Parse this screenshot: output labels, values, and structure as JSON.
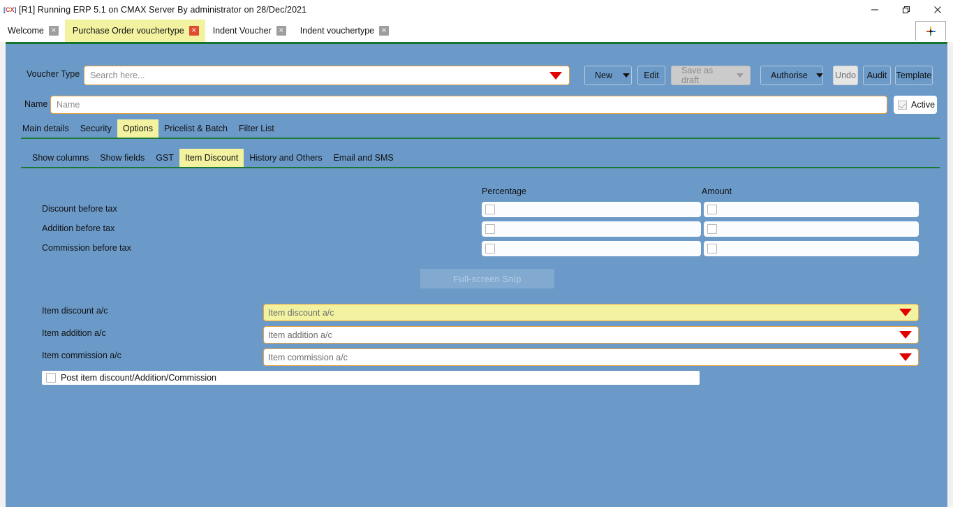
{
  "window": {
    "title": "[R1] Running ERP 5.1 on CMAX Server By administrator on 28/Dec/2021",
    "app_icon_text": "CX",
    "minimize_icon": "minimize-icon",
    "maximize_icon": "restore-icon",
    "close_icon": "close-icon"
  },
  "tabs": {
    "items": [
      {
        "label": "Welcome",
        "active": false,
        "close": "×"
      },
      {
        "label": "Purchase Order vouchertype",
        "active": true,
        "close": "×"
      },
      {
        "label": "Indent Voucher",
        "active": false,
        "close": "×"
      },
      {
        "label": "Indent vouchertype",
        "active": false,
        "close": "×"
      }
    ],
    "new_tab_label": "+"
  },
  "toolbar": {
    "voucher_type_label": "Voucher Type",
    "search_placeholder": "Search here...",
    "search_value": "",
    "buttons": [
      {
        "label": "New",
        "split": true,
        "disabled": false
      },
      {
        "label": "Edit",
        "split": false,
        "disabled": false
      },
      {
        "label": "Save as draft",
        "split": true,
        "disabled": true
      },
      {
        "label": "Authorise",
        "split": true,
        "disabled": false
      },
      {
        "label": "Undo",
        "split": false,
        "disabled": true
      },
      {
        "label": "Audit",
        "split": false,
        "disabled": false
      },
      {
        "label": "Template",
        "split": false,
        "disabled": false
      }
    ]
  },
  "name_row": {
    "label": "Name",
    "placeholder": "Name",
    "value": "",
    "active_label": "Active",
    "active_checked": true
  },
  "primary_tabs": [
    {
      "label": "Main details",
      "active": false
    },
    {
      "label": "Security",
      "active": false
    },
    {
      "label": "Options",
      "active": true
    },
    {
      "label": "Pricelist & Batch",
      "active": false
    },
    {
      "label": "Filter List",
      "active": false
    }
  ],
  "secondary_tabs": [
    {
      "label": "Show columns",
      "active": false
    },
    {
      "label": "Show fields",
      "active": false
    },
    {
      "label": "GST",
      "active": false
    },
    {
      "label": "Item Discount",
      "active": true
    },
    {
      "label": "History and Others",
      "active": false
    },
    {
      "label": "Email and SMS",
      "active": false
    }
  ],
  "form": {
    "column_headers": {
      "percentage": "Percentage",
      "amount": "Amount"
    },
    "checkbox_rows": [
      {
        "label": "Discount before tax",
        "percentage_checked": false,
        "amount_checked": false
      },
      {
        "label": "Addition before tax",
        "percentage_checked": false,
        "amount_checked": false
      },
      {
        "label": "Commission before tax",
        "percentage_checked": false,
        "amount_checked": false
      }
    ],
    "account_rows": [
      {
        "label": "Item discount a/c",
        "placeholder": "Item discount a/c",
        "value": "",
        "focused": true
      },
      {
        "label": "Item addition a/c",
        "placeholder": "Item addition a/c",
        "value": "",
        "focused": false
      },
      {
        "label": "Item commission a/c",
        "placeholder": "Item commission a/c",
        "value": "",
        "focused": false
      }
    ],
    "post_row": {
      "label": "Post item discount/Addition/Commission",
      "checked": false
    }
  },
  "watermark": {
    "text": "Full-screen Snip"
  },
  "colors": {
    "app_background": "#6b9ac9",
    "active_tab": "#f2f2a0",
    "field_border": "#e8a33d",
    "separator_green": "#1a7a33",
    "dropdown_arrow_red": "#e00000",
    "tab_close_red": "#e04a2f"
  }
}
